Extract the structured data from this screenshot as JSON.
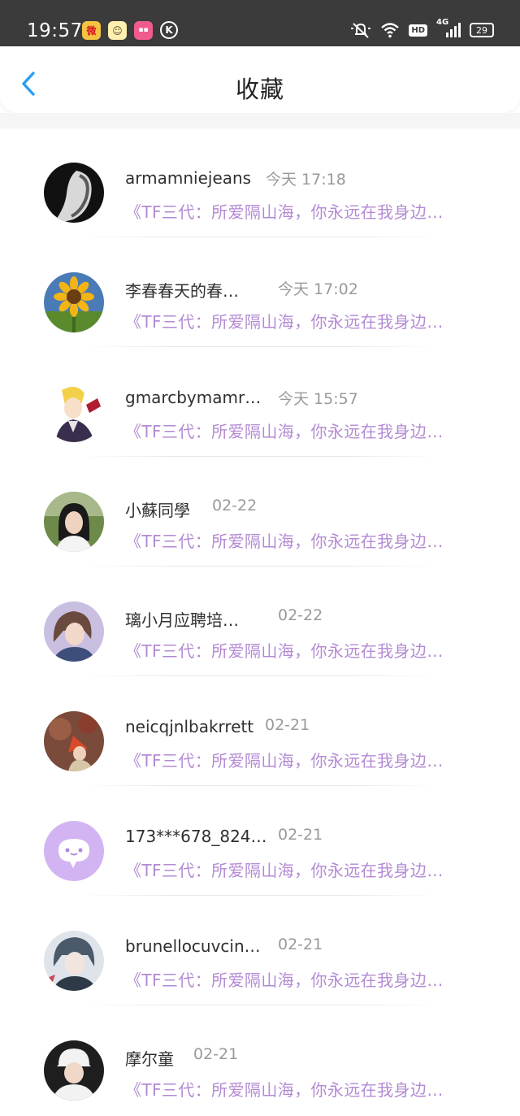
{
  "status_bar": {
    "time": "19:57",
    "app_icons": [
      "weibo-icon",
      "mascot-app-icon",
      "pink-app-icon",
      "k-circle-icon"
    ],
    "hd_label": "HD",
    "network_label": "4G",
    "battery": "29"
  },
  "header": {
    "title": "收藏",
    "back_icon": "chevron-left-icon",
    "accent_color": "#2a9df4"
  },
  "colors": {
    "snippet": "#b38ad3",
    "name": "#2f2f2f",
    "time": "#9a9a9a"
  },
  "items": [
    {
      "name": "armamniejeans",
      "time": "今天 17:18",
      "snippet": "《TF三代：所爱隔山海，你永远在我身边…"
    },
    {
      "name": "李春春天的春…",
      "time": "今天 17:02",
      "snippet": "《TF三代：所爱隔山海，你永远在我身边…"
    },
    {
      "name": "gmarcbymamr…",
      "time": "今天 15:57",
      "snippet": "《TF三代：所爱隔山海，你永远在我身边…"
    },
    {
      "name": "小蘇同學",
      "time": "02-22",
      "snippet": "《TF三代：所爱隔山海，你永远在我身边…"
    },
    {
      "name": "璃小月应聘培…",
      "time": "02-22",
      "snippet": "《TF三代：所爱隔山海，你永远在我身边…"
    },
    {
      "name": "neicqjnlbakrrett",
      "time": "02-21",
      "snippet": "《TF三代：所爱隔山海，你永远在我身边…"
    },
    {
      "name": "173***678_824…",
      "time": "02-21",
      "snippet": "《TF三代：所爱隔山海，你永远在我身边…"
    },
    {
      "name": "brunellocuvcin…",
      "time": "02-21",
      "snippet": "《TF三代：所爱隔山海，你永远在我身边…"
    },
    {
      "name": "摩尔童",
      "time": "02-21",
      "snippet": "《TF三代：所爱隔山海，你永远在我身边…"
    }
  ]
}
